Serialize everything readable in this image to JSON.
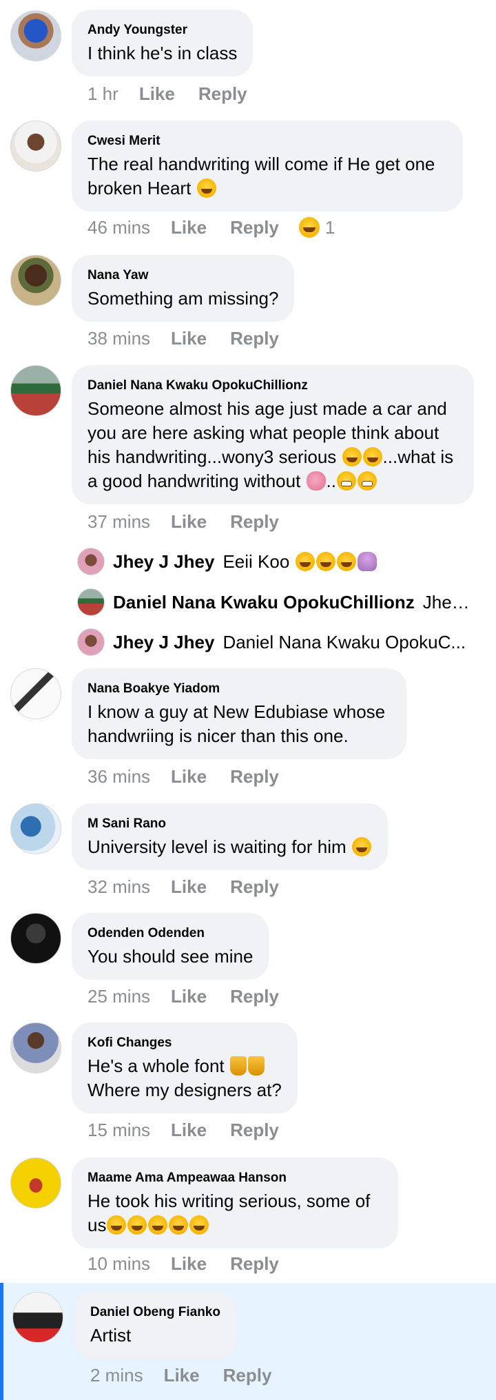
{
  "comments": [
    {
      "author": "Andy Youngster",
      "text": "I think he's in class",
      "time": "1 hr",
      "like": "Like",
      "reply": "Reply"
    },
    {
      "author": "Cwesi Merit",
      "text": "The real handwriting will come if He get one broken Heart",
      "time": "46 mins",
      "like": "Like",
      "reply": "Reply",
      "reaction_count": "1"
    },
    {
      "author": "Nana Yaw",
      "text": "Something am missing?",
      "time": "38 mins",
      "like": "Like",
      "reply": "Reply"
    },
    {
      "author": "Daniel Nana Kwaku OpokuChillionz",
      "text_parts": [
        "Someone almost his age just made a car and you are here asking what people think about his handwriting...wony3 serious ",
        "...what is a good handwriting without ",
        ".."
      ],
      "time": "37 mins",
      "like": "Like",
      "reply": "Reply"
    },
    {
      "author": "Nana Boakye Yiadom",
      "text": "I know a guy at New Edubiase whose handwriing is nicer than this one.",
      "time": "36 mins",
      "like": "Like",
      "reply": "Reply"
    },
    {
      "author": "M Sani Rano",
      "text": "University level is waiting for him",
      "time": "32 mins",
      "like": "Like",
      "reply": "Reply"
    },
    {
      "author": "Odenden Odenden",
      "text": "You should see mine",
      "time": "25 mins",
      "like": "Like",
      "reply": "Reply"
    },
    {
      "author": "Kofi Changes",
      "text_lines": [
        "He's a whole font ",
        "Where my designers at?"
      ],
      "time": "15 mins",
      "like": "Like",
      "reply": "Reply"
    },
    {
      "author": "Maame Ama Ampeawaa Hanson",
      "text_parts": [
        "He took his writing serious, some of us"
      ],
      "time": "10 mins",
      "like": "Like",
      "reply": "Reply"
    },
    {
      "author": "Daniel Obeng Fianko",
      "text": "Artist",
      "time": "2 mins",
      "like": "Like",
      "reply": "Reply"
    }
  ],
  "replies": [
    {
      "author": "Jhey J Jhey",
      "text": "Eeii Koo "
    },
    {
      "author": "Daniel Nana Kwaku OpokuChillionz",
      "text": "Jhey..."
    },
    {
      "author": "Jhey J Jhey",
      "text": "Daniel Nana Kwaku OpokuC..."
    }
  ],
  "colors": {
    "bubble": "#f0f2f5",
    "meta": "#8a8d91",
    "highlight": "#e7f3ff",
    "accent": "#1877f2"
  }
}
